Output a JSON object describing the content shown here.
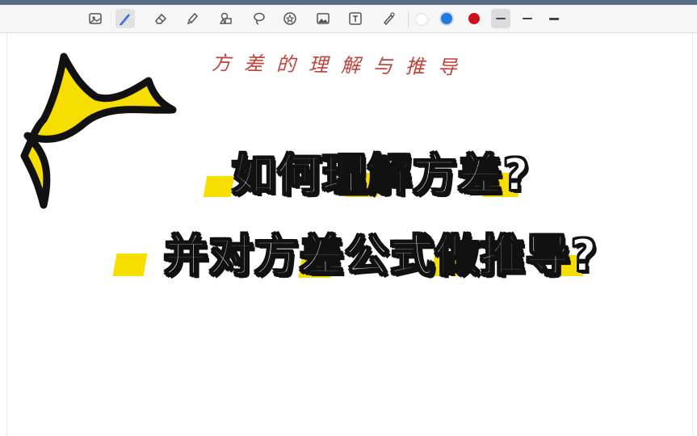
{
  "toolbar": {
    "tools": [
      {
        "name": "image-viewer-icon"
      },
      {
        "name": "pen-icon",
        "selected": true
      },
      {
        "name": "eraser-icon"
      },
      {
        "name": "highlighter-icon"
      },
      {
        "name": "shapes-icon"
      },
      {
        "name": "lasso-icon"
      },
      {
        "name": "sticker-icon"
      },
      {
        "name": "image-icon"
      },
      {
        "name": "text-box-icon"
      },
      {
        "name": "laser-pointer-icon"
      }
    ],
    "colors": [
      "#ffffff",
      "#1f7ae0",
      "#d10f1a"
    ],
    "selected_color": "#1f7ae0",
    "strokes": [
      "thin",
      "medium",
      "thick"
    ]
  },
  "canvas": {
    "handwritten_title": "方差的理解与推导",
    "headline_line1": "如何理解方差?",
    "headline_line2": "并对方差公式做推导?",
    "accent_color": "#f6df00"
  }
}
